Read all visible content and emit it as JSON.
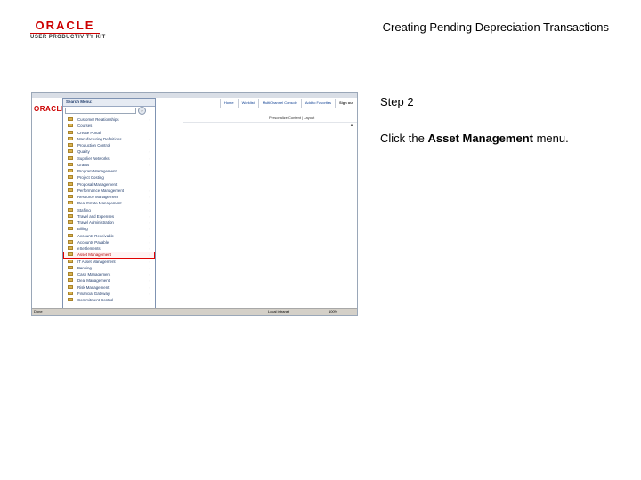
{
  "logo": {
    "brand": "ORACLE",
    "product": "USER PRODUCTIVITY KIT"
  },
  "document_title": "Creating Pending Depreciation Transactions",
  "step": {
    "label": "Step 2"
  },
  "instruction": {
    "prefix": "Click the",
    "target": "Asset Management",
    "suffix": "menu."
  },
  "screenshot": {
    "oracle_logo": "ORACLE",
    "nav_links": [
      "Home",
      "Worklist",
      "MultiChannel Console",
      "Add to Favorites",
      "Sign out"
    ],
    "personalize": "Personalize Content | Layout",
    "status": {
      "left": "Done",
      "zone": "Local intranet",
      "zoom": "100%"
    },
    "menu": {
      "title": "Search Menu:",
      "go_label": "»",
      "items": [
        {
          "label": "Customer Relationships",
          "submenu": true
        },
        {
          "label": "Courses",
          "submenu": false
        },
        {
          "label": "Create Portal",
          "submenu": false
        },
        {
          "label": "Manufacturing Definitions",
          "submenu": true
        },
        {
          "label": "Production Control",
          "submenu": false
        },
        {
          "label": "Quality",
          "submenu": true
        },
        {
          "label": "Supplier Networks",
          "submenu": true
        },
        {
          "label": "Grants",
          "submenu": true
        },
        {
          "label": "Program Management",
          "submenu": false
        },
        {
          "label": "Project Costing",
          "submenu": false
        },
        {
          "label": "Proposal Management",
          "submenu": false
        },
        {
          "label": "Performance Management",
          "submenu": true
        },
        {
          "label": "Resource Management",
          "submenu": true
        },
        {
          "label": "Real Estate Management",
          "submenu": true
        },
        {
          "label": "Staffing",
          "submenu": true
        },
        {
          "label": "Travel and Expenses",
          "submenu": true
        },
        {
          "label": "Travel Administration",
          "submenu": true
        },
        {
          "label": "Billing",
          "submenu": true
        },
        {
          "label": "Accounts Receivable",
          "submenu": true
        },
        {
          "label": "Accounts Payable",
          "submenu": true
        },
        {
          "label": "eSettlements",
          "submenu": true
        },
        {
          "label": "Asset Management",
          "submenu": true,
          "highlighted": true
        },
        {
          "label": "IT Asset Management",
          "submenu": true
        },
        {
          "label": "Banking",
          "submenu": true
        },
        {
          "label": "Cash Management",
          "submenu": true
        },
        {
          "label": "Deal Management",
          "submenu": true
        },
        {
          "label": "Risk Management",
          "submenu": true
        },
        {
          "label": "Financial Gateway",
          "submenu": true
        },
        {
          "label": "Commitment Control",
          "submenu": true
        }
      ]
    }
  }
}
